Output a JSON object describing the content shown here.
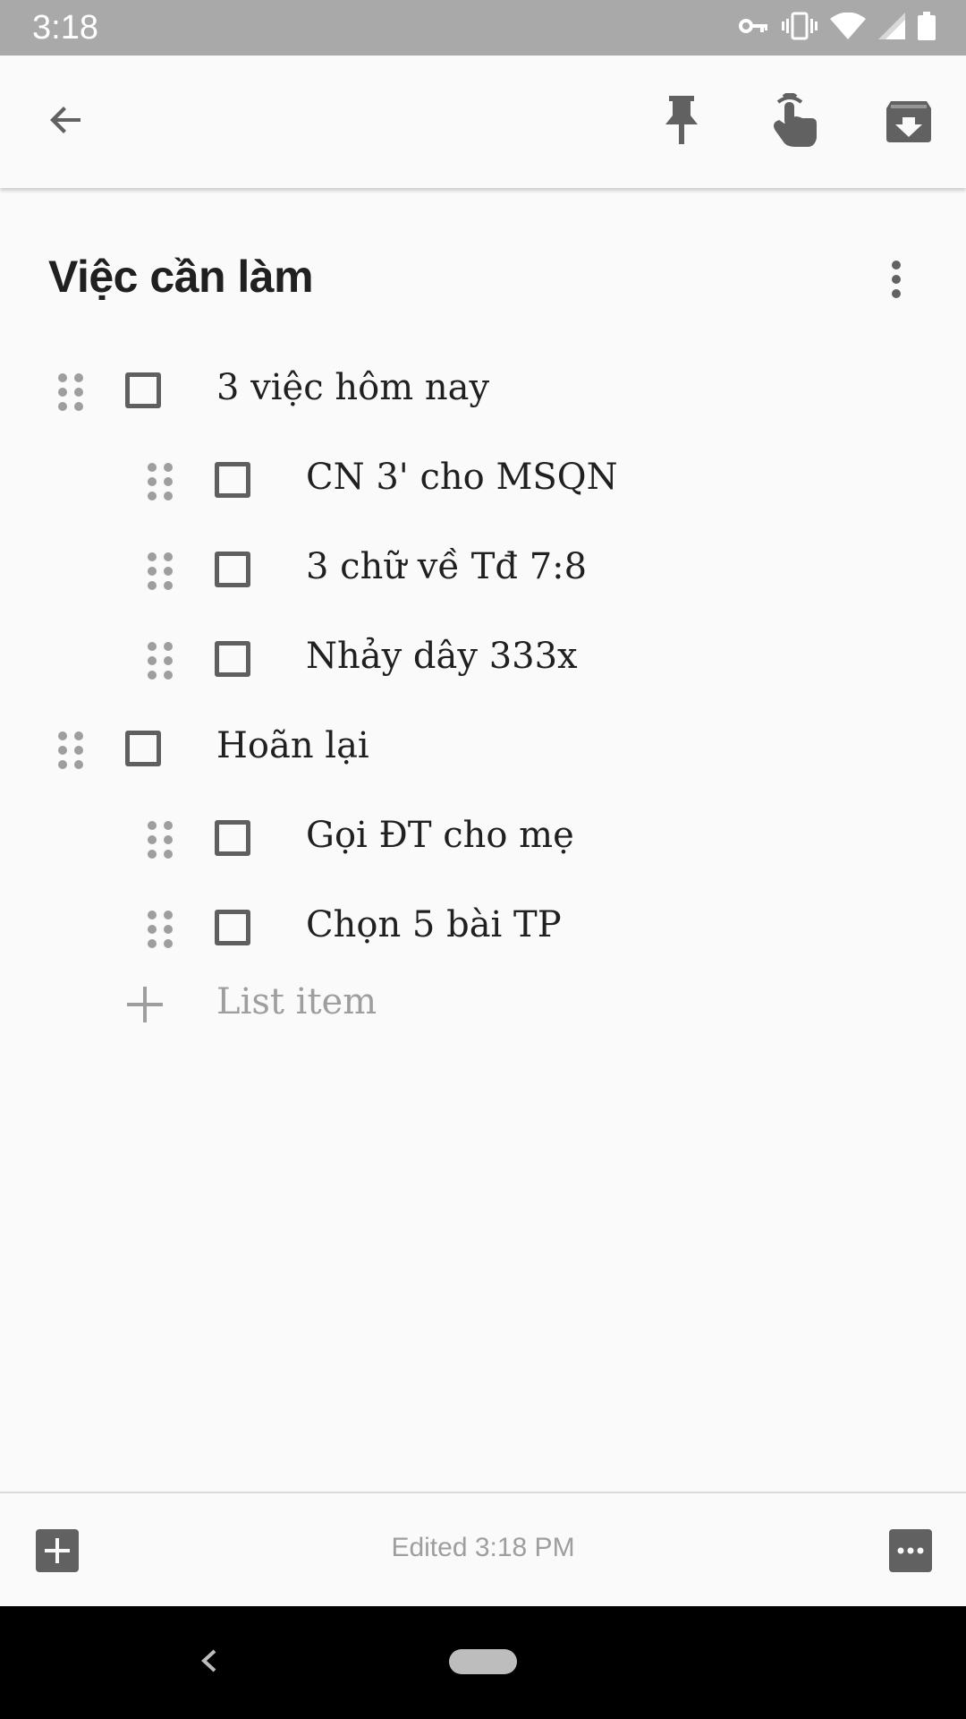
{
  "status_bar": {
    "time": "3:18",
    "icons": [
      "vpn-key-icon",
      "vibrate-icon",
      "wifi-icon",
      "cell-signal-icon",
      "battery-icon"
    ]
  },
  "toolbar": {
    "icons": [
      "back-arrow-icon",
      "pin-icon",
      "reminder-hand-icon",
      "archive-icon"
    ]
  },
  "note": {
    "title": "Việc cần làm",
    "items": [
      {
        "text": "3 việc hôm nay",
        "checked": false,
        "indent": 0
      },
      {
        "text": "CN 3' cho MSQN",
        "checked": false,
        "indent": 1
      },
      {
        "text": "3 chữ về Tđ 7:8",
        "checked": false,
        "indent": 1
      },
      {
        "text": "Nhảy dây 333x",
        "checked": false,
        "indent": 1
      },
      {
        "text": "Hoãn lại",
        "checked": false,
        "indent": 0
      },
      {
        "text": "Gọi ĐT cho mẹ",
        "checked": false,
        "indent": 1
      },
      {
        "text": "Chọn 5 bài TP",
        "checked": false,
        "indent": 1
      }
    ],
    "add_item_placeholder": "List item"
  },
  "bottom_bar": {
    "edited_label": "Edited 3:18 PM"
  },
  "colors": {
    "background": "#fafafa",
    "status_bar": "#a9a9a9",
    "icon": "#616161",
    "text": "#202020",
    "muted_text": "#9e9e9e",
    "nav_bar": "#000000"
  }
}
